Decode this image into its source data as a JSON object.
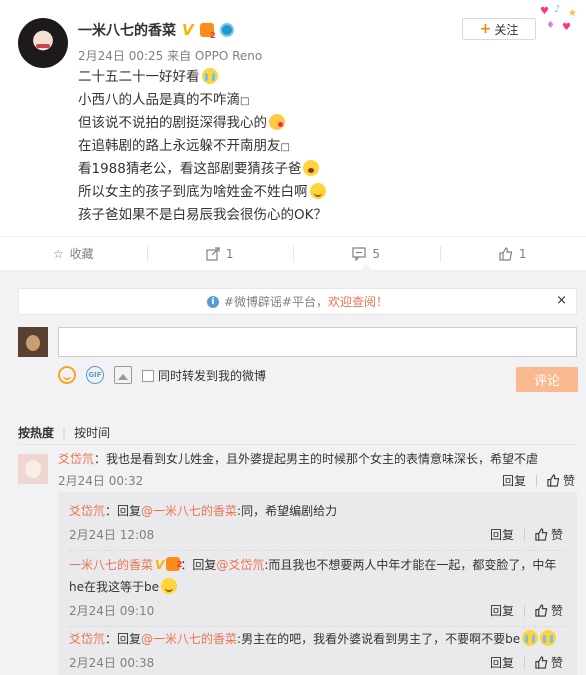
{
  "post": {
    "author": "一米八七的香菜",
    "meta": "2月24日 00:25 来自 OPPO Reno",
    "lines": [
      "二十五二十一好好看",
      "小西八的人品是真的不咋滴",
      "但该说不说拍的剧挺深得我心的",
      "在追韩剧的路上永远躲不开南朋友",
      "看1988猜老公，看这部剧要猜孩子爸",
      "所以女主的孩子到底为啥姓金不姓白啊",
      "孩子爸如果不是白易辰我会很伤心的OK？"
    ],
    "follow_label": "关注"
  },
  "actions": {
    "favorite_label": "收藏",
    "repost_count": "1",
    "comment_count": "5",
    "like_count": "1"
  },
  "composer": {
    "notice_prefix": "#微博辟谣#平台，",
    "notice_link": "欢迎查阅！",
    "close": "×",
    "repost_option": "同时转发到我的微博",
    "submit_label": "评论"
  },
  "sort": {
    "hot": "按热度",
    "time": "按时间"
  },
  "comment": {
    "user": "爻岱氘",
    "text": "：我也是看到女儿姓金，且外婆提起男主的时候那个女主的表情意味深长，希望不虐",
    "time": "2月24日 00:32",
    "reply_label": "回复",
    "like_label": "赞"
  },
  "replies": [
    {
      "user": "爻岱氘",
      "prefix": "：回复",
      "mention": "@一米八七的香菜",
      "text": ":同，希望编剧给力",
      "time": "2月24日 12:08"
    },
    {
      "user": "一米八七的香菜",
      "prefix": "：回复",
      "mention": "@爻岱氘",
      "text": ":而且我也不想要两人中年才能在一起，都变脸了，中年",
      "text2": "he在我这等于be",
      "time": "2月24日 09:10"
    },
    {
      "user": "爻岱氘",
      "prefix": "：回复",
      "mention": "@一米八七的香菜",
      "text": ":男主在的吧，我看外婆说看到男主了，不要啊不要be",
      "time": "2月24日 00:38"
    }
  ],
  "reply_label": "回复",
  "like_label": "赞",
  "colors": {
    "accent": "#eb7350",
    "submit": "#fbb990",
    "vip": "#f6b400",
    "bg": "#f2f2f5"
  }
}
